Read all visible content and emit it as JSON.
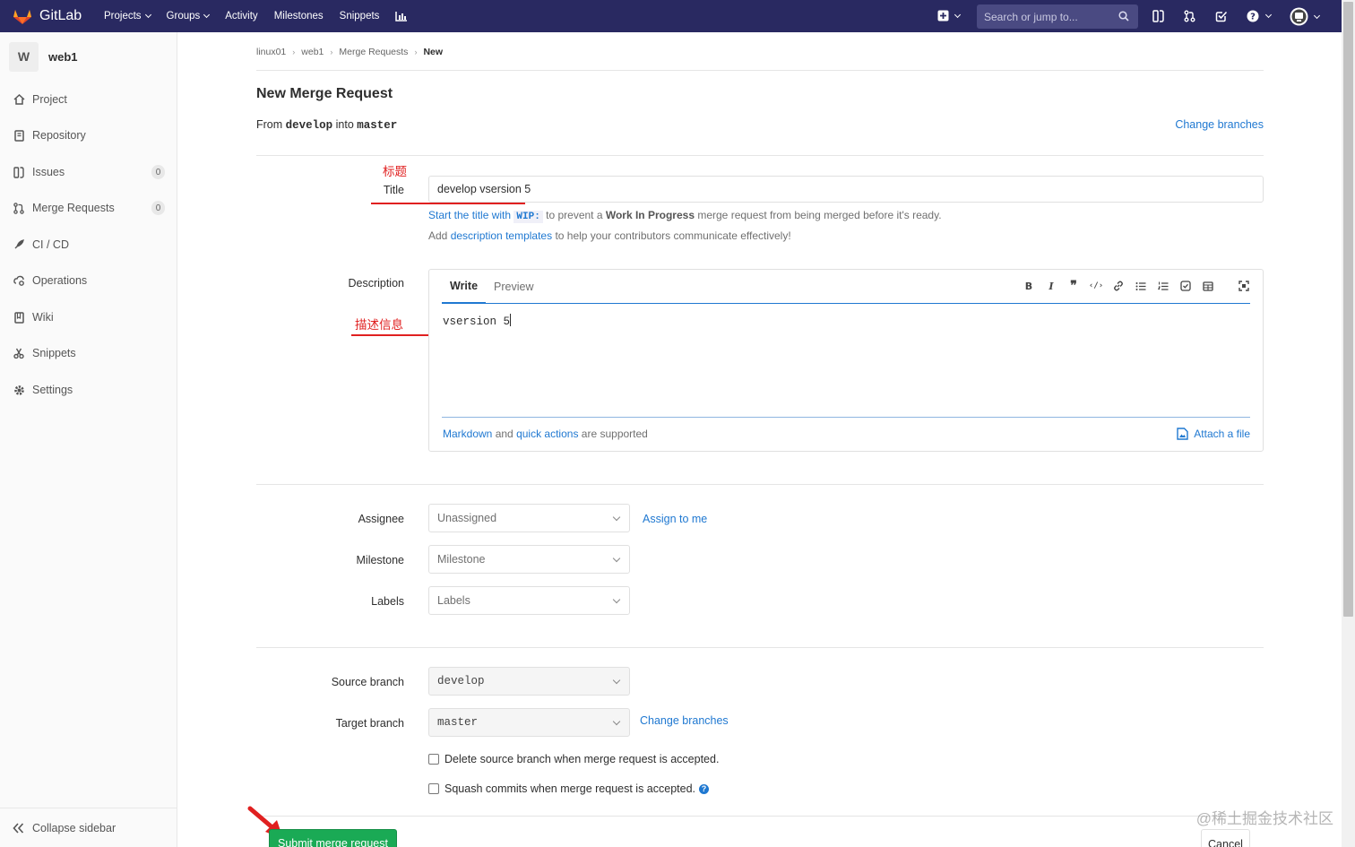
{
  "nav": {
    "brand": "GitLab",
    "links": [
      "Projects",
      "Groups",
      "Activity",
      "Milestones",
      "Snippets"
    ],
    "search_placeholder": "Search or jump to..."
  },
  "sidebar": {
    "avatar_letter": "W",
    "project_name": "web1",
    "items": [
      {
        "label": "Project",
        "icon": "home-icon"
      },
      {
        "label": "Repository",
        "icon": "book-icon"
      },
      {
        "label": "Issues",
        "icon": "issues-icon",
        "count": "0"
      },
      {
        "label": "Merge Requests",
        "icon": "merge-request-icon",
        "count": "0"
      },
      {
        "label": "CI / CD",
        "icon": "rocket-icon"
      },
      {
        "label": "Operations",
        "icon": "cloud-gear-icon"
      },
      {
        "label": "Wiki",
        "icon": "wiki-book-icon"
      },
      {
        "label": "Snippets",
        "icon": "scissors-icon"
      },
      {
        "label": "Settings",
        "icon": "gear-icon"
      }
    ],
    "collapse_label": "Collapse sidebar"
  },
  "breadcrumbs": [
    "linux01",
    "web1",
    "Merge Requests",
    "New"
  ],
  "page": {
    "title": "New Merge Request",
    "from_prefix": "From",
    "source": "develop",
    "into": "into",
    "target": "master",
    "change_branches": "Change branches"
  },
  "form": {
    "title_label": "Title",
    "title_annotation": "标题",
    "title_value": "develop vsersion 5",
    "wip_hint": {
      "link": "Start the title with",
      "code": "WIP:",
      "text1": "to prevent a",
      "bold": "Work In Progress",
      "text2": "merge request from being merged before it's ready."
    },
    "template_hint": {
      "prefix": "Add",
      "link": "description templates",
      "suffix": "to help your contributors communicate effectively!"
    },
    "description_label": "Description",
    "description_annotation": "描述信息",
    "tab_write": "Write",
    "tab_preview": "Preview",
    "description_value": "vsersion 5",
    "markdown_link": "Markdown",
    "and": "and",
    "quick_actions_link": "quick actions",
    "supported": "are supported",
    "attach_file": "Attach a file",
    "assignee_label": "Assignee",
    "assignee_value": "Unassigned",
    "assign_to_me": "Assign to me",
    "milestone_label": "Milestone",
    "milestone_value": "Milestone",
    "labels_label": "Labels",
    "labels_value": "Labels",
    "source_branch_label": "Source branch",
    "source_branch_value": "develop",
    "target_branch_label": "Target branch",
    "target_branch_value": "master",
    "change_branches": "Change branches",
    "delete_source": "Delete source branch when merge request is accepted.",
    "squash": "Squash commits when merge request is accepted.",
    "help_glyph": "?",
    "submit": "Submit merge request",
    "cancel": "Cancel"
  },
  "watermark": "@稀土掘金技术社区",
  "colors": {
    "navbar": "#292961",
    "link": "#1f78d1",
    "submit": "#1aaa55",
    "annotation": "#e02020"
  }
}
